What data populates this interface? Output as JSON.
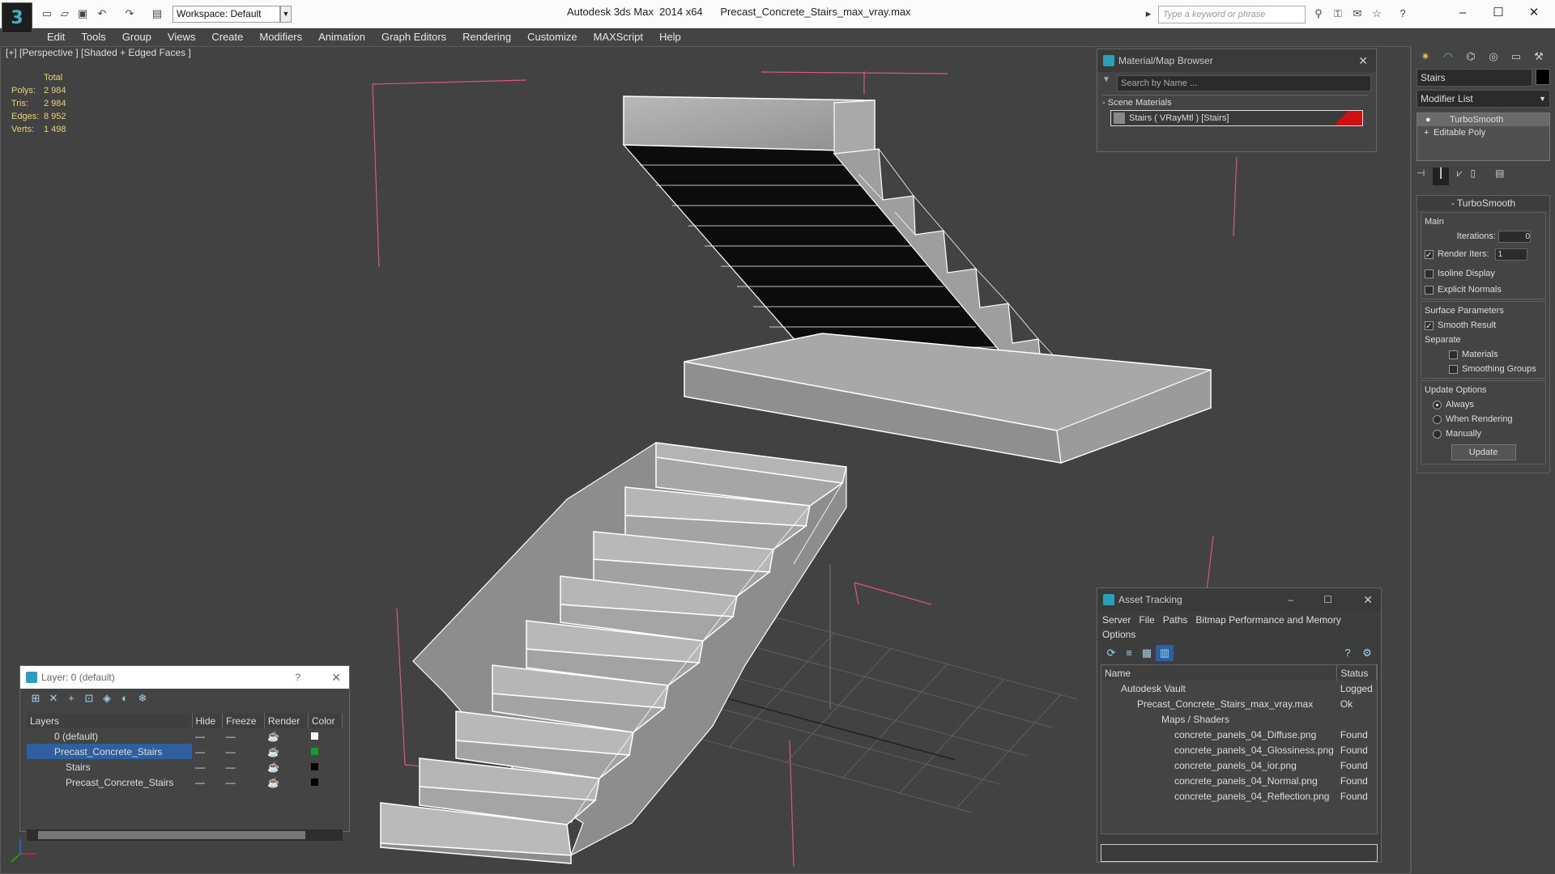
{
  "app": {
    "title": "Autodesk 3ds Max  2014 x64",
    "file": "Precast_Concrete_Stairs_max_vray.max",
    "workspace": "Workspace: Default",
    "search_placeholder": "Type a keyword or phrase"
  },
  "menu": [
    "Edit",
    "Tools",
    "Group",
    "Views",
    "Create",
    "Modifiers",
    "Animation",
    "Graph Editors",
    "Rendering",
    "Customize",
    "MAXScript",
    "Help"
  ],
  "viewport": {
    "label": "[+] [Perspective ] [Shaded + Edged Faces ]",
    "stats": {
      "header": "Total",
      "rows": [
        {
          "k": "Polys:",
          "v": "2 984"
        },
        {
          "k": "Tris:",
          "v": "2 984"
        },
        {
          "k": "Edges:",
          "v": "8 952"
        },
        {
          "k": "Verts:",
          "v": "1 498"
        }
      ]
    }
  },
  "material_browser": {
    "title": "Material/Map Browser",
    "search": "Search by Name ...",
    "section": "Scene Materials",
    "item": "Stairs  ( VRayMtl )  [Stairs]"
  },
  "asset_tracking": {
    "title": "Asset Tracking",
    "menu": [
      "Server",
      "File",
      "Paths",
      "Bitmap Performance and Memory"
    ],
    "menu2": "Options",
    "headers": [
      "Name",
      "Status"
    ],
    "rows": [
      {
        "name": "Autodesk Vault",
        "status": "Logged"
      },
      {
        "name": "Precast_Concrete_Stairs_max_vray.max",
        "status": "Ok"
      },
      {
        "name": "Maps / Shaders",
        "status": ""
      },
      {
        "name": "concrete_panels_04_Diffuse.png",
        "status": "Found"
      },
      {
        "name": "concrete_panels_04_Glossiness.png",
        "status": "Found"
      },
      {
        "name": "concrete_panels_04_ior.png",
        "status": "Found"
      },
      {
        "name": "concrete_panels_04_Normal.png",
        "status": "Found"
      },
      {
        "name": "concrete_panels_04_Reflection.png",
        "status": "Found"
      }
    ]
  },
  "layers": {
    "title": "Layer: 0 (default)",
    "help": "?",
    "headers": [
      "Layers",
      "Hide",
      "Freeze",
      "Render",
      "Color"
    ],
    "rows": [
      {
        "name": "0 (default)"
      },
      {
        "name": "Precast_Concrete_Stairs"
      },
      {
        "name": "Stairs"
      },
      {
        "name": "Precast_Concrete_Stairs"
      }
    ]
  },
  "command_panel": {
    "object_name": "Stairs",
    "modifier_list": "Modifier List",
    "stack": [
      "TurboSmooth",
      "Editable Poly"
    ],
    "rollout": "TurboSmooth",
    "main": "Main",
    "iterations_label": "Iterations:",
    "iterations": "0",
    "render_iters_label": "Render Iters:",
    "render_iters": "1",
    "isoline": "Isoline Display",
    "explicit": "Explicit Normals",
    "surface": "Surface Parameters",
    "smooth": "Smooth Result",
    "separate": "Separate",
    "materials": "Materials",
    "smoothing": "Smoothing Groups",
    "update_options": "Update Options",
    "always": "Always",
    "when_rendering": "When Rendering",
    "manually": "Manually",
    "update": "Update"
  },
  "colors": {
    "accent": "#2e5fa0",
    "wire": "#ffffff",
    "stat": "#e8d07a"
  }
}
